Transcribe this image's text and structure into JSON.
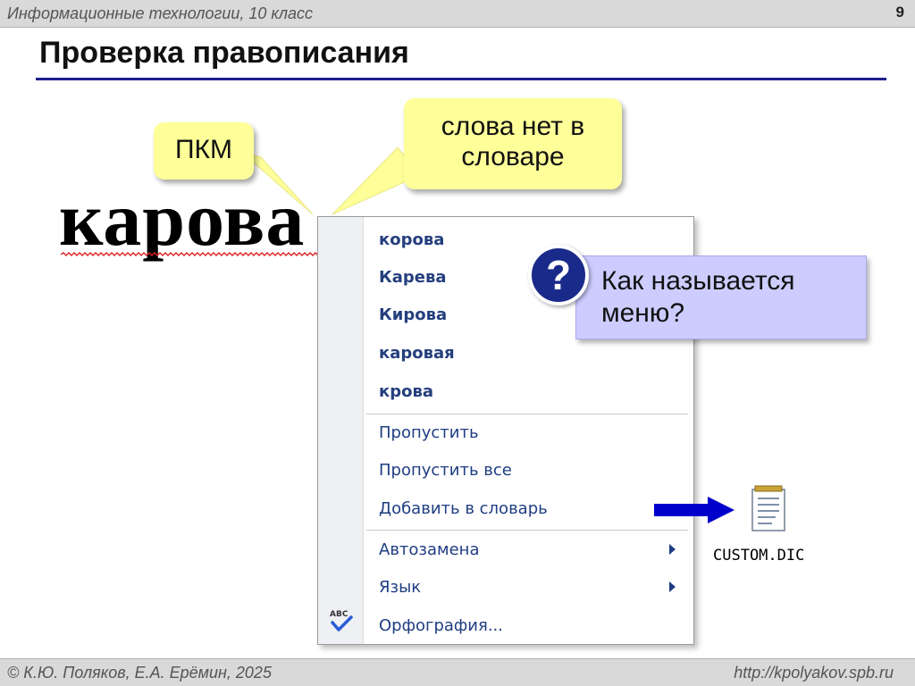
{
  "header": {
    "course": "Информационные технологии, 10 класс",
    "page_number": "9"
  },
  "slide": {
    "title": "Проверка правописания"
  },
  "document": {
    "word": "карова"
  },
  "callouts": {
    "pkm": "ПКМ",
    "not_in_dict": "слова нет в словаре"
  },
  "context_menu": {
    "suggestions": [
      "корова",
      "Карева",
      "Кирова",
      "каровая",
      "крова"
    ],
    "actions": [
      "Пропустить",
      "Пропустить все",
      "Добавить в словарь"
    ],
    "submenus": [
      "Автозамена",
      "Язык"
    ],
    "spelling": "Орфография..."
  },
  "question": {
    "badge": "?",
    "text": "Как называется меню?"
  },
  "file": {
    "name": "CUSTOM.DIC",
    "icon": "text-file-icon"
  },
  "footer": {
    "copyright": "© К.Ю. Поляков, Е.А. Ерёмин, 2025",
    "site": "http://kpolyakov.spb.ru"
  },
  "colors": {
    "callout": "#ffff99",
    "question_box": "#ccccff",
    "badge": "#1a2a8a",
    "arrow": "#0000cc",
    "title_rule": "#1f1f8f"
  }
}
